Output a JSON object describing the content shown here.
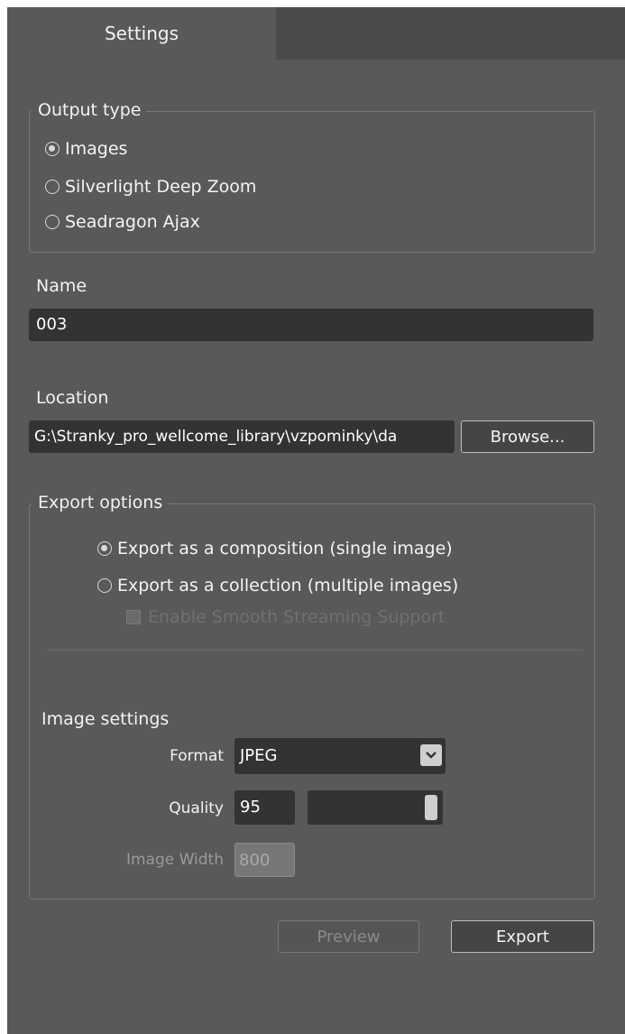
{
  "tabs": {
    "settings": "Settings"
  },
  "output_type": {
    "legend": "Output type",
    "options": [
      "Images",
      "Silverlight Deep Zoom",
      "Seadragon Ajax"
    ],
    "selected": "Images"
  },
  "name": {
    "label": "Name",
    "value": "003"
  },
  "location": {
    "label": "Location",
    "value": "G:\\Stranky_pro_wellcome_library\\vzpominky\\da",
    "browse_label": "Browse..."
  },
  "export_options": {
    "legend": "Export options",
    "options": [
      "Export as a composition (single image)",
      "Export as a collection (multiple images)"
    ],
    "selected": "Export as a composition (single image)",
    "smooth_streaming_label": "Enable Smooth Streaming Support"
  },
  "image_settings": {
    "heading": "Image settings",
    "format_label": "Format",
    "format_value": "JPEG",
    "quality_label": "Quality",
    "quality_value": "95",
    "image_width_label": "Image Width",
    "image_width_value": "800"
  },
  "actions": {
    "preview_label": "Preview",
    "export_label": "Export"
  },
  "colors": {
    "panel": "#595959",
    "tab_strip": "#4b4b4b",
    "input": "#333333"
  }
}
